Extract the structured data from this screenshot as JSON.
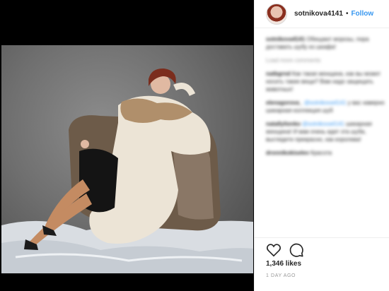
{
  "post": {
    "username": "sotnikova4141",
    "separator": "•",
    "follow_label": "Follow",
    "likes": "1,346 likes",
    "time": "1 DAY AGO"
  },
  "comments": [
    {
      "user": "sotnikova4141",
      "text": "Обещают морозы, пора доставать шубу из шкафа!",
      "muted": false
    },
    {
      "user": "",
      "text": "Load more comments",
      "muted": true
    },
    {
      "user": "natbgrnd",
      "text": "Как такая женщина, как вы может носить такие вещи? Вам надо защищать животных!",
      "muted": false
    },
    {
      "user": "elenagorova_",
      "tag": "@sotnikova4141",
      "text": "у вас наверно шикарная коллекция шуб",
      "muted": false
    },
    {
      "user": "natallylionko",
      "tag": "@sotnikova4141",
      "text": "шикарная женщина! И вам очень идет эта шуба, выглядите прекрасно, как королева!",
      "muted": false
    },
    {
      "user": "dronnikokiselev",
      "text": "Красота",
      "muted": false
    }
  ],
  "icons": {
    "like": "heart-icon",
    "comment": "comment-icon"
  },
  "colors": {
    "link": "#3897f0",
    "text": "#262626",
    "muted": "#999999",
    "media_bg": "#000000"
  }
}
